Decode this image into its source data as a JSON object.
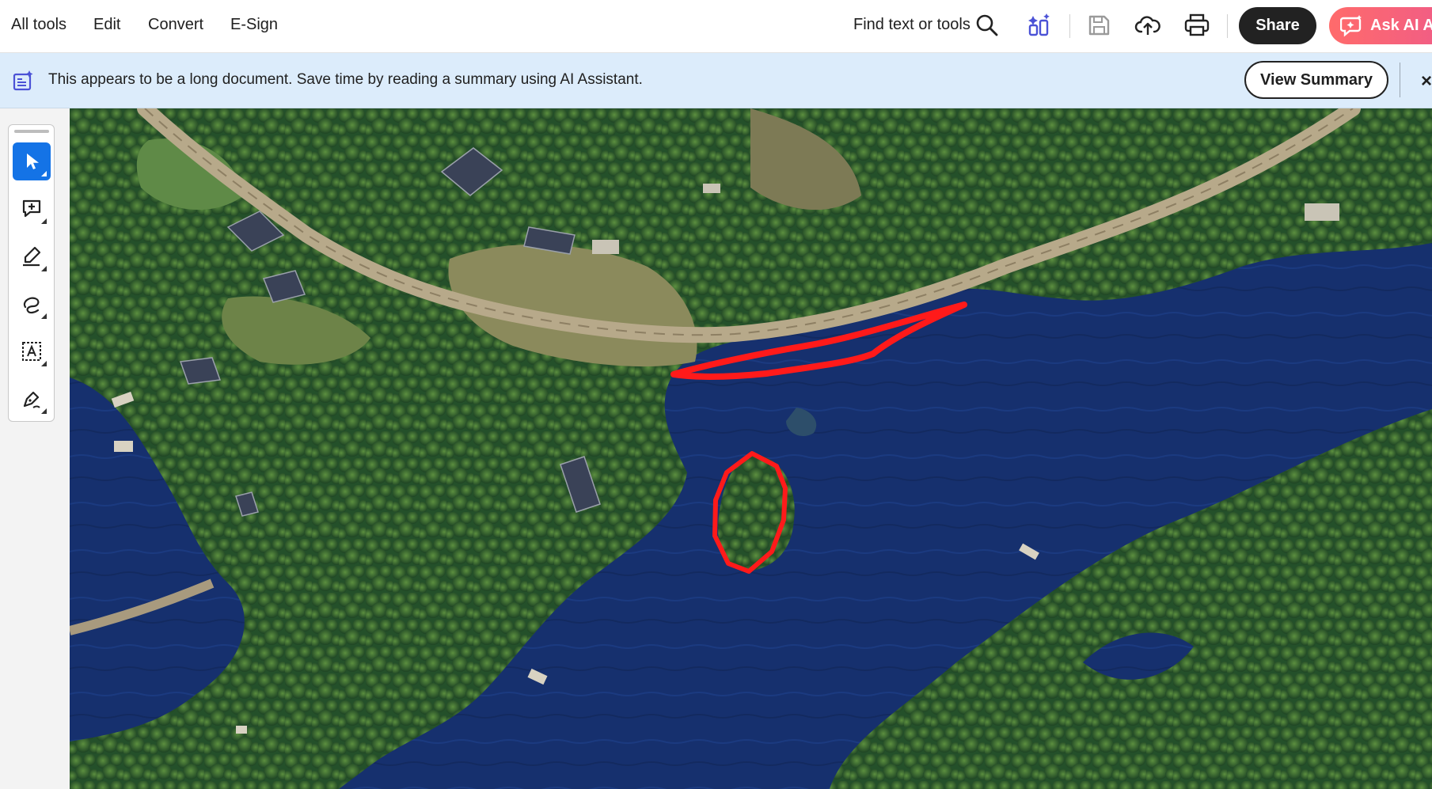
{
  "menu": {
    "all_tools": "All tools",
    "edit": "Edit",
    "convert": "Convert",
    "esign": "E-Sign"
  },
  "toolbar": {
    "find_label": "Find text or tools",
    "share_label": "Share",
    "ask_ai_label": "Ask AI As",
    "icons": [
      "search-icon",
      "ai-generate-icon",
      "save-icon",
      "cloud-upload-icon",
      "print-icon"
    ]
  },
  "banner": {
    "message": "This appears to be a long document. Save time by reading a summary using AI Assistant.",
    "button_label": "View Summary",
    "close_glyph": "×"
  },
  "tool_rail": {
    "tools": [
      "select-tool",
      "add-comment-tool",
      "highlight-tool",
      "draw-tool",
      "text-select-tool",
      "fill-sign-tool"
    ],
    "active_tool": "select-tool"
  },
  "document": {
    "content": "aerial satellite image of shoreline, road and wooded island",
    "annotations": [
      {
        "type": "freehand-line",
        "color": "#ff1a1a"
      },
      {
        "type": "freehand-loop",
        "color": "#ff1a1a"
      }
    ]
  },
  "colors": {
    "accent": "#1473e6",
    "share_bg": "#222222",
    "ask_ai_gradient": [
      "#ff6b6b",
      "#ee5a8a"
    ],
    "banner_bg": "#dcecfb",
    "annotation": "#ff1a1a",
    "water": "#142a62",
    "forest": "#2f5d2c"
  }
}
